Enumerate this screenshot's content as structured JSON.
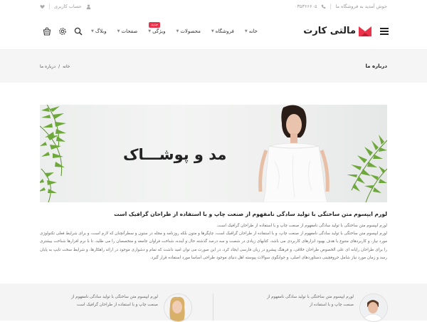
{
  "topbar": {
    "welcome": "خوش آمدید به فروشگاه ما",
    "phone": "۰۳۵۳۶۶۶۰۵",
    "account": "حساب کاربری"
  },
  "header": {
    "logo_text": "مالتی کارت",
    "nav": [
      {
        "label": "خانه",
        "has_menu": true
      },
      {
        "label": "فروشگاه",
        "has_menu": true
      },
      {
        "label": "محصولات",
        "has_menu": true
      },
      {
        "label": "ویژگی",
        "has_menu": true,
        "badge": "جدید"
      },
      {
        "label": "صفحات",
        "has_menu": true
      },
      {
        "label": "وبلاگ",
        "has_menu": true
      }
    ],
    "accent_color": "#e8334a"
  },
  "page_band": {
    "title": "درباره ما",
    "breadcrumb": [
      "خانه",
      "درباره ما"
    ],
    "separator": "/"
  },
  "hero": {
    "title": "مد و پوشـــاک"
  },
  "about": {
    "heading": "لورم ایپسوم متن ساختگی با تولید سادگی نامفهوم از صنعت چاپ و با استفاده از طراحان گرافیک است",
    "paragraph_1": "لورم ایپسوم متن ساختگی با تولید سادگی نامفهوم از صنعت چاپ و با استفاده از طراحان گرافیک است.",
    "paragraph_2": "لورم ایپسوم متن ساختگی با تولید سادگی نامفهوم از صنعت چاپ، و با استفاده از طراحان گرافیک است، چاپگرها و متون بلکه روزنامه و مجله در ستون و سطرآنچنان که لازم است، و برای شرایط فعلی تکنولوژی مورد نیاز، و کاربردهای متنوع با هدف بهبود ابزارهای کاربردی می باشد، کتابهای زیادی در شصت و سه درصد گذشته حال و آینده، شناخت فراوان جامعه و متخصصان را می طلبد، تا با نرم افزارها شناخت بیشتری را برای طراحان رایانه ای علی الخصوص طراحان خلاقی، و فرهنگ پیشرو در زبان فارسی ایجاد کرد، در این صورت می توان امید داشت که تمام و دشواری موجود در ارائه راهکارها، و شرایط سخت تایپ به پایان رسد و زمان مورد نیاز شامل حروفچینی دستاوردهای اصلی، و جوابگوی سوالات پیوسته اهل دنیای موجود طراحی اساسا مورد استفاده قرار گیرد."
  },
  "testimonials": [
    {
      "text": "لورم ایپسوم متن ساختگی با تولید سادگی نامفهوم از صنعت چاپ و با استفاده از"
    },
    {
      "text": "لورم ایپسوم متن ساختگی با تولید سادگی نامفهوم از صنعت چاپ و با استفاده از طراحان گرافیک است"
    }
  ]
}
